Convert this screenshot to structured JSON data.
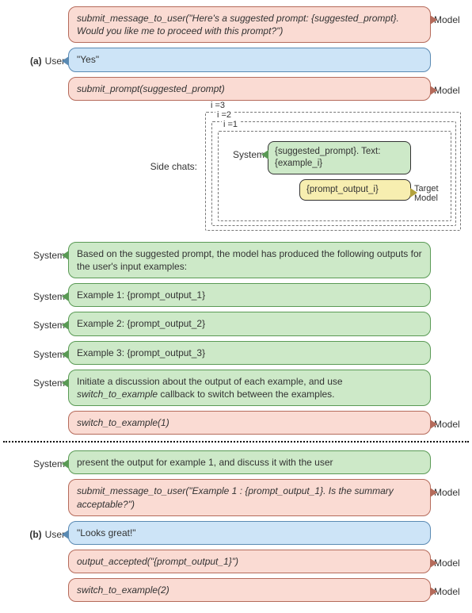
{
  "markers": {
    "a": "(a)",
    "b": "(b)"
  },
  "roles": {
    "user": "User",
    "model": "Model",
    "system": "System",
    "target_model": "Target Model",
    "side_chats": "Side chats:"
  },
  "nested": {
    "i1": "i =1",
    "i2": "i =2",
    "i3": "i =3"
  },
  "msgs": {
    "m1": "submit_message_to_user(\"Here's a suggested prompt: {suggested_prompt}. Would you like me to proceed with this prompt?\")",
    "m2": "\"Yes\"",
    "m3": "submit_prompt(suggested_prompt)",
    "side_sys": "{suggested_prompt}. Text: {example_i}",
    "side_out": "{prompt_output_i}",
    "m4": "Based on the suggested prompt, the model has produced the following outputs for the user's input examples:",
    "m5": "Example 1: {prompt_output_1}",
    "m6": "Example 2: {prompt_output_2}",
    "m7": "Example 3: {prompt_output_3}",
    "m8a": "Initiate a discussion about the output of each example, and use ",
    "m8b": "switch_to_example",
    "m8c": " callback to switch between the examples.",
    "m9": "switch_to_example(1)",
    "m10": "present the output for example 1, and discuss it with the user",
    "m11": "submit_message_to_user(\"Example 1 : {prompt_output_1}. Is the summary acceptable?\")",
    "m12": "\"Looks great!\"",
    "m13": "output_accepted(\"{prompt_output_1}\")",
    "m14": "switch_to_example(2)"
  }
}
